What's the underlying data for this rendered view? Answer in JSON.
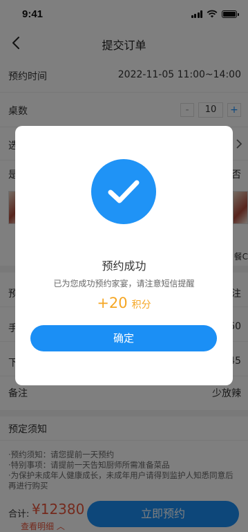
{
  "status_bar": {
    "time": "9:41"
  },
  "nav": {
    "title": "提交订单"
  },
  "form": {
    "booking_time": {
      "label": "预约时间",
      "value": "2022-11-05  11:00~14:00"
    },
    "tables": {
      "label": "桌数",
      "value": "10",
      "minus": "-",
      "plus": "+"
    },
    "row3": {
      "label": "选"
    },
    "row4": {
      "label": "是",
      "right": "否"
    },
    "dish_right_label": "餐C",
    "row5": {
      "label": "预",
      "right": "注"
    },
    "row6": {
      "label": "手",
      "right": "60"
    },
    "row7": {
      "label": "下",
      "right": ":45"
    },
    "remark": {
      "label": "备注",
      "value": "少放辣"
    }
  },
  "notes": {
    "title": "预定须知",
    "items": [
      "·预约须知：请您提前一天预约",
      "·特别事项：请提前一天告知厨师所需准备菜品",
      "·为保护未成年人健康成长，未成年用户请得到监护人知悉同意后再进行购买"
    ]
  },
  "bottom": {
    "total_label": "合计:",
    "total_value": "¥12380",
    "detail_link": "查看明细 ︿",
    "book_button": "立即预约"
  },
  "modal": {
    "title": "预约成功",
    "subtitle": "已为您成功预约家宴，请注意短信提醒",
    "points_value": "+20",
    "points_unit": "积分",
    "confirm": "确定"
  },
  "colors": {
    "accent": "#1b8ff5",
    "price": "#e8543a",
    "points": "#f5a623"
  }
}
